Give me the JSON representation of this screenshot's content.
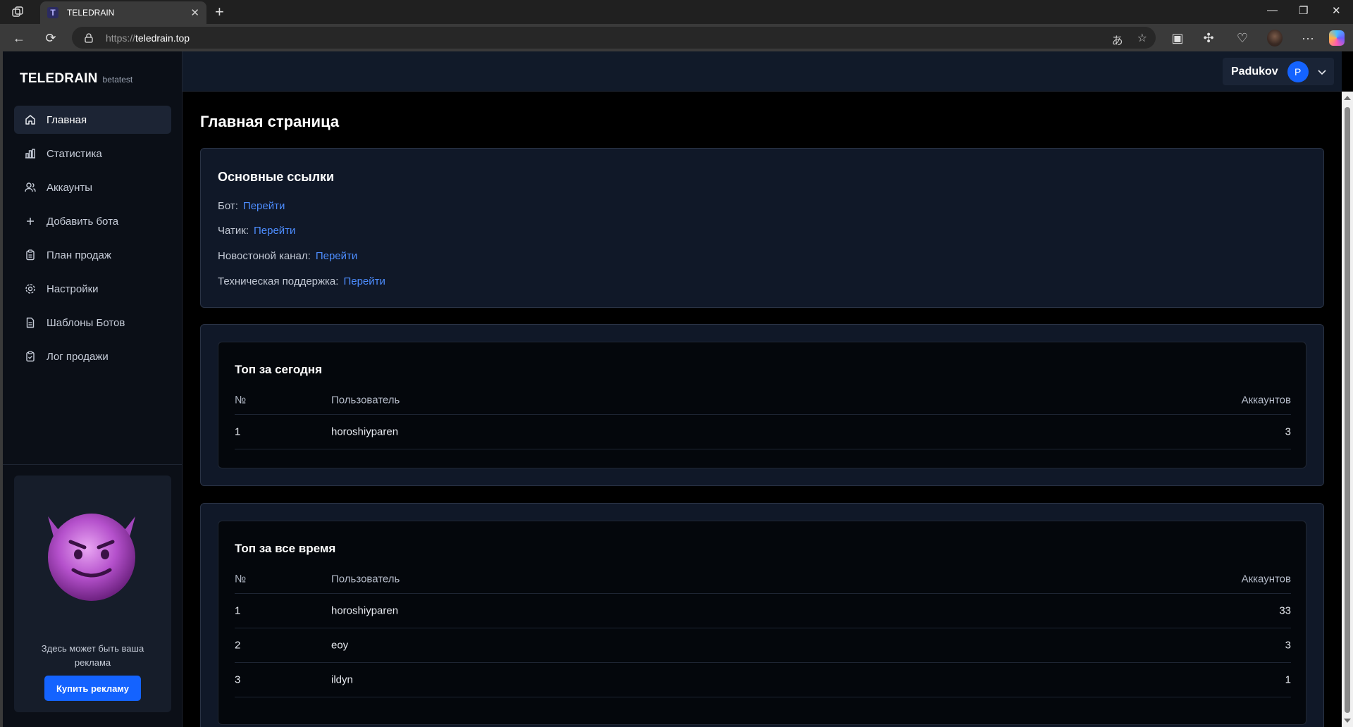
{
  "browser": {
    "tab_title": "TELEDRAIN",
    "favicon_letter": "T",
    "url_scheme": "https://",
    "url_host": "teledrain.top"
  },
  "sidebar": {
    "logo": "TELEDRAIN",
    "logo_sub": "betatest",
    "items": [
      {
        "label": "Главная",
        "icon": "home-icon",
        "active": true
      },
      {
        "label": "Статистика",
        "icon": "bar-chart-icon"
      },
      {
        "label": "Аккаунты",
        "icon": "users-icon"
      },
      {
        "label": "Добавить бота",
        "icon": "plus-icon"
      },
      {
        "label": "План продаж",
        "icon": "clipboard-icon"
      },
      {
        "label": "Настройки",
        "icon": "gear-icon"
      },
      {
        "label": "Шаблоны Ботов",
        "icon": "document-icon"
      },
      {
        "label": "Лог продажи",
        "icon": "clipboard-check-icon"
      }
    ],
    "ad": {
      "text": "Здесь может быть ваша реклама",
      "button": "Купить рекламу"
    }
  },
  "header": {
    "user_name": "Padukov",
    "avatar_letter": "P"
  },
  "main": {
    "title": "Главная страница",
    "links": {
      "title": "Основные ссылки",
      "rows": [
        {
          "label": "Бот:",
          "link": "Перейти"
        },
        {
          "label": "Чатик:",
          "link": "Перейти"
        },
        {
          "label": "Новостоной канал:",
          "link": "Перейти"
        },
        {
          "label": "Техническая поддержка:",
          "link": "Перейти"
        }
      ]
    },
    "top_today": {
      "title": "Топ за сегодня",
      "columns": [
        "№",
        "Пользователь",
        "Аккаунтов"
      ],
      "rows": [
        [
          "1",
          "horoshiyparen",
          "3"
        ]
      ]
    },
    "top_all": {
      "title": "Топ за все время",
      "columns": [
        "№",
        "Пользователь",
        "Аккаунтов"
      ],
      "rows": [
        [
          "1",
          "horoshiyparen",
          "33"
        ],
        [
          "2",
          "eoy",
          "3"
        ],
        [
          "3",
          "ildyn",
          "1"
        ]
      ]
    }
  },
  "colors": {
    "accent": "#1463ff",
    "link": "#4d8dff",
    "background": "#000000",
    "card": "#101828"
  }
}
